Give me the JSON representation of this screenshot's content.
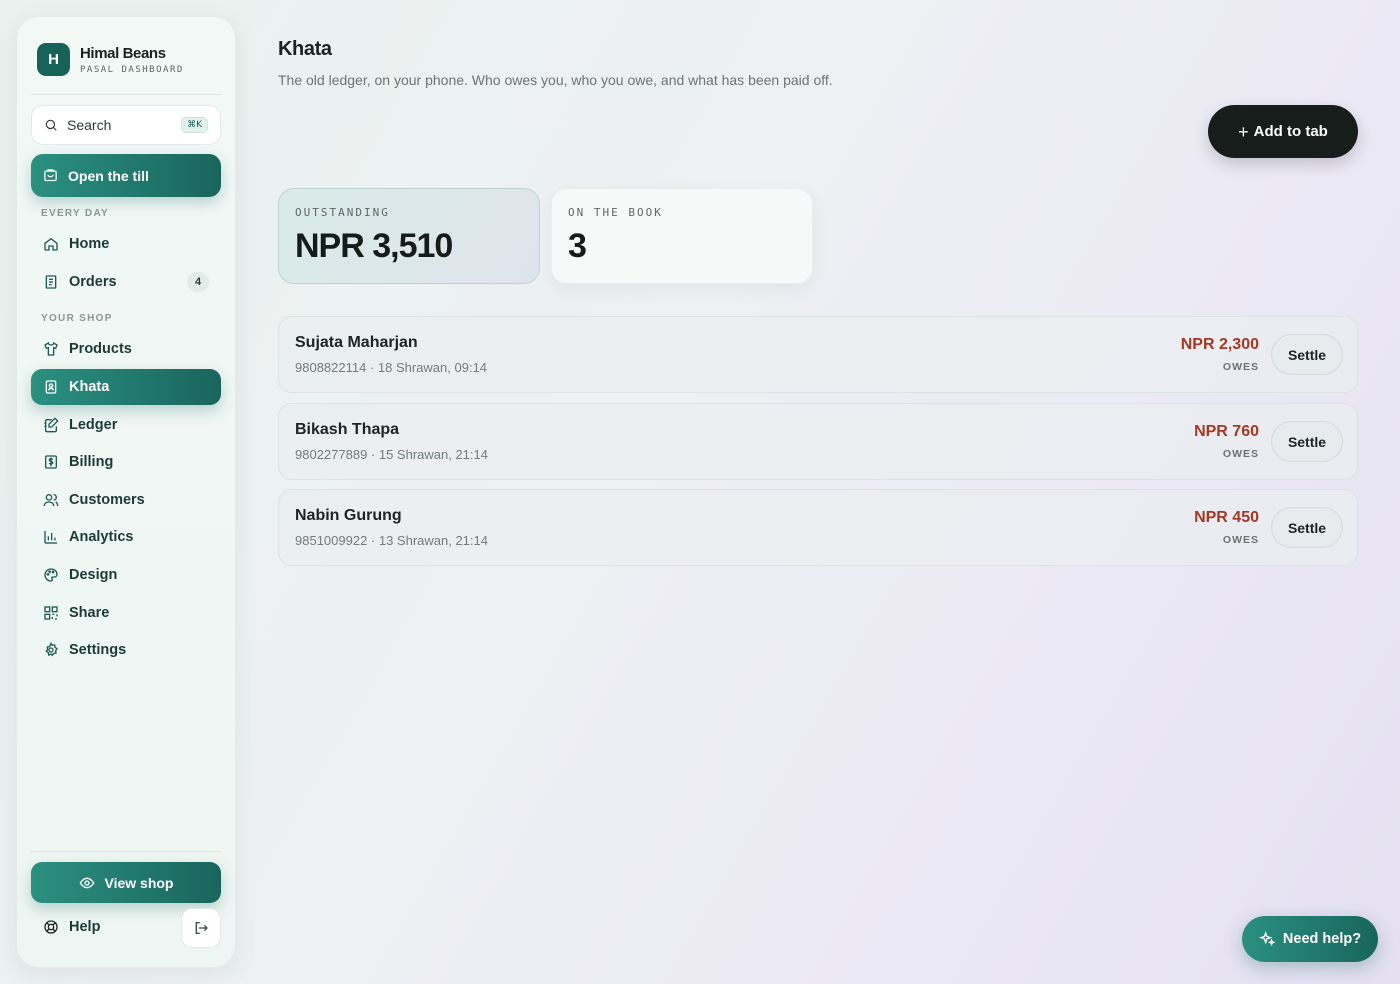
{
  "brand": {
    "logo_letter": "H",
    "name": "Himal Beans",
    "subtitle": "PASAL DASHBOARD"
  },
  "search": {
    "label": "Search",
    "shortcut": "⌘K"
  },
  "till_button": "Open the till",
  "sections": {
    "every_day": "EVERY DAY",
    "your_shop": "YOUR SHOP"
  },
  "nav": {
    "home": "Home",
    "orders": "Orders",
    "orders_badge": "4",
    "products": "Products",
    "khata": "Khata",
    "ledger": "Ledger",
    "billing": "Billing",
    "customers": "Customers",
    "analytics": "Analytics",
    "design": "Design",
    "share": "Share",
    "settings": "Settings"
  },
  "view_shop": "View shop",
  "help": "Help",
  "page": {
    "title": "Khata",
    "subtitle": "The old ledger, on your phone. Who owes you, who you owe, and what has been paid off."
  },
  "add_button": "Add to tab",
  "stats": {
    "outstanding_label": "OUTSTANDING",
    "outstanding_value": "NPR 3,510",
    "on_book_label": "ON THE BOOK",
    "on_book_value": "3"
  },
  "entries": [
    {
      "name": "Sujata Maharjan",
      "meta": "9808822114 · 18 Shrawan, 09:14",
      "amount": "NPR 2,300",
      "status": "OWES",
      "action": "Settle"
    },
    {
      "name": "Bikash Thapa",
      "meta": "9802277889 · 15 Shrawan, 21:14",
      "amount": "NPR 760",
      "status": "OWES",
      "action": "Settle"
    },
    {
      "name": "Nabin Gurung",
      "meta": "9851009922 · 13 Shrawan, 21:14",
      "amount": "NPR 450",
      "status": "OWES",
      "action": "Settle"
    }
  ],
  "need_help": "Need help?",
  "colors": {
    "accent": "#19655c",
    "owes": "#a13a24",
    "dark_button": "#171d1b"
  }
}
